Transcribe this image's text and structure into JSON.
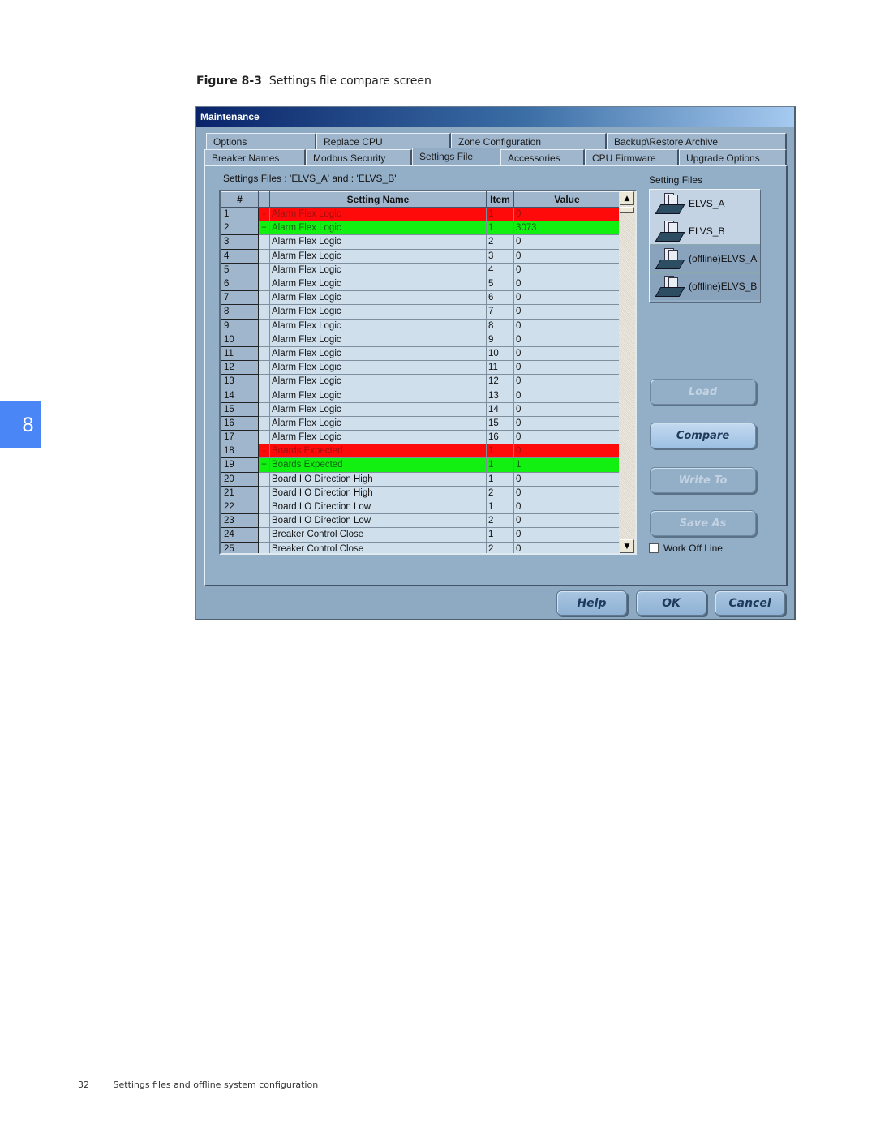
{
  "caption": {
    "label": "Figure 8-3",
    "text": "Settings file compare screen"
  },
  "chapter_tab": "8",
  "footer": {
    "page_number": "32",
    "section": "Settings files and offline system configuration"
  },
  "window": {
    "title": "Maintenance",
    "tabs_row1": [
      "Options",
      "Replace CPU",
      "Zone Configuration",
      "Backup\\Restore Archive"
    ],
    "tabs_row2": [
      "Breaker Names",
      "Modbus Security",
      "Settings File",
      "Accessories",
      "CPU Firmware",
      "Upgrade Options"
    ],
    "active_tab": "Settings File",
    "panel_title": "Settings Files : 'ELVS_A' and : 'ELVS_B'",
    "grid": {
      "columns": [
        "#",
        "",
        "Setting Name",
        "Item",
        "Value"
      ],
      "rows": [
        {
          "num": "1",
          "mark": "-",
          "name": "Alarm Flex Logic",
          "item": "1",
          "value": "0",
          "status": "removed"
        },
        {
          "num": "2",
          "mark": "+",
          "name": "Alarm Flex Logic",
          "item": "1",
          "value": "3073",
          "status": "added"
        },
        {
          "num": "3",
          "mark": "",
          "name": "Alarm Flex Logic",
          "item": "2",
          "value": "0",
          "status": ""
        },
        {
          "num": "4",
          "mark": "",
          "name": "Alarm Flex Logic",
          "item": "3",
          "value": "0",
          "status": ""
        },
        {
          "num": "5",
          "mark": "",
          "name": "Alarm Flex Logic",
          "item": "4",
          "value": "0",
          "status": ""
        },
        {
          "num": "6",
          "mark": "",
          "name": "Alarm Flex Logic",
          "item": "5",
          "value": "0",
          "status": ""
        },
        {
          "num": "7",
          "mark": "",
          "name": "Alarm Flex Logic",
          "item": "6",
          "value": "0",
          "status": ""
        },
        {
          "num": "8",
          "mark": "",
          "name": "Alarm Flex Logic",
          "item": "7",
          "value": "0",
          "status": ""
        },
        {
          "num": "9",
          "mark": "",
          "name": "Alarm Flex Logic",
          "item": "8",
          "value": "0",
          "status": ""
        },
        {
          "num": "10",
          "mark": "",
          "name": "Alarm Flex Logic",
          "item": "9",
          "value": "0",
          "status": ""
        },
        {
          "num": "11",
          "mark": "",
          "name": "Alarm Flex Logic",
          "item": "10",
          "value": "0",
          "status": ""
        },
        {
          "num": "12",
          "mark": "",
          "name": "Alarm Flex Logic",
          "item": "11",
          "value": "0",
          "status": ""
        },
        {
          "num": "13",
          "mark": "",
          "name": "Alarm Flex Logic",
          "item": "12",
          "value": "0",
          "status": ""
        },
        {
          "num": "14",
          "mark": "",
          "name": "Alarm Flex Logic",
          "item": "13",
          "value": "0",
          "status": ""
        },
        {
          "num": "15",
          "mark": "",
          "name": "Alarm Flex Logic",
          "item": "14",
          "value": "0",
          "status": ""
        },
        {
          "num": "16",
          "mark": "",
          "name": "Alarm Flex Logic",
          "item": "15",
          "value": "0",
          "status": ""
        },
        {
          "num": "17",
          "mark": "",
          "name": "Alarm Flex Logic",
          "item": "16",
          "value": "0",
          "status": ""
        },
        {
          "num": "18",
          "mark": "-",
          "name": "Boards Expected",
          "item": "1",
          "value": "0",
          "status": "removed"
        },
        {
          "num": "19",
          "mark": "+",
          "name": "Boards Expected",
          "item": "1",
          "value": "1",
          "status": "added"
        },
        {
          "num": "20",
          "mark": "",
          "name": "Board I O Direction High",
          "item": "1",
          "value": "0",
          "status": ""
        },
        {
          "num": "21",
          "mark": "",
          "name": "Board I O Direction High",
          "item": "2",
          "value": "0",
          "status": ""
        },
        {
          "num": "22",
          "mark": "",
          "name": "Board I O Direction Low",
          "item": "1",
          "value": "0",
          "status": ""
        },
        {
          "num": "23",
          "mark": "",
          "name": "Board I O Direction Low",
          "item": "2",
          "value": "0",
          "status": ""
        },
        {
          "num": "24",
          "mark": "",
          "name": "Breaker Control Close",
          "item": "1",
          "value": "0",
          "status": ""
        },
        {
          "num": "25",
          "mark": "",
          "name": "Breaker Control Close",
          "item": "2",
          "value": "0",
          "status": ""
        }
      ]
    },
    "setting_files_label": "Setting Files",
    "setting_files": [
      "ELVS_A",
      "ELVS_B",
      "(offline)ELVS_A",
      "(offline)ELVS_B"
    ],
    "actions": {
      "load": "Load",
      "compare": "Compare",
      "write_to": "Write To",
      "save_as": "Save As"
    },
    "work_off_line": {
      "label": "Work Off Line",
      "checked": false
    },
    "footer_buttons": {
      "help": "Help",
      "ok": "OK",
      "cancel": "Cancel"
    },
    "colors": {
      "removed": "#ff0a0a",
      "added": "#12f012",
      "panel": "#93aec7"
    }
  }
}
